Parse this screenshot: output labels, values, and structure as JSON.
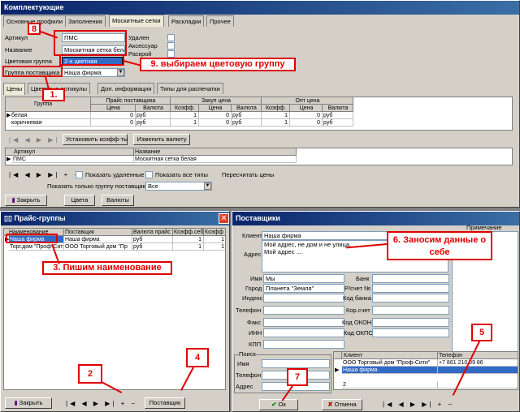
{
  "main": {
    "title": "Комплектующие",
    "tabs": [
      "Основные профили",
      "Заполнения",
      "Москитные сетки",
      "Раскладки",
      "Прочее"
    ],
    "fields": {
      "article_label": "Артикул",
      "article_value": "ПМС",
      "name_label": "Название",
      "name_value": "Москитная сетка белая",
      "colorgroup_label": "Цветовая группа",
      "colorgroup_value": "2-х цветная",
      "suppliergroup_label": "Группа поставщика",
      "suppliergroup_value": "Наша фирма",
      "deleted_label": "Удален",
      "accessory_label": "Аксессуар",
      "cutting_label": "Раскрой"
    },
    "subtabs": [
      "Цены",
      "Цветовые артикулы",
      "Доп. информация",
      "Типы для распечатки"
    ],
    "price_table": {
      "group_headers": [
        "Прайс поставщика",
        "Закуп цена",
        "Опт цена"
      ],
      "columns": [
        "Группа",
        "Цена",
        "Валюта",
        "Коэфф.",
        "Цена",
        "Валюта",
        "Коэфф.",
        "Цена",
        "Валюта"
      ],
      "rows": [
        [
          "белая",
          "0",
          "руб",
          "1",
          "0",
          "руб",
          "1",
          "0",
          "руб"
        ],
        [
          "коричневая",
          "0",
          "руб",
          "1",
          "0",
          "руб",
          "1",
          "0",
          "руб"
        ]
      ]
    },
    "set_coef_button": "Установить коэфф-ты",
    "change_currency_button": "Изменить валюту",
    "list_columns": [
      "Артикул",
      "Название"
    ],
    "list_rows": [
      [
        "ПМС",
        "Москитная сетка белая"
      ]
    ],
    "show_deleted": "Показать удаленные",
    "show_all_types": "Показать все типы",
    "recalc_prices": "Пересчитать цены",
    "show_only_group_label": "Показать только группу поставщика",
    "show_only_group_value": "Все",
    "close_button": "Закрыть",
    "colors_button": "Цвета",
    "currencies_button": "Валюты"
  },
  "price_groups": {
    "title": "Прайс-группы",
    "columns": [
      "Наименование",
      "Поставщик",
      "Валюта прайс",
      "Коэфф.себ",
      "Коэфф"
    ],
    "rows": [
      [
        "Наша фирма",
        "Наша фирма",
        "руб",
        "1",
        "1"
      ],
      [
        "Торг.дом \"Проф-Сити\"",
        "ООО Торговый дом \"Пр",
        "руб",
        "1",
        "1"
      ]
    ],
    "close_button": "Закрыть",
    "supplier_button": "Поставщик"
  },
  "suppliers": {
    "title": "Поставщики",
    "note_header": "Примечание",
    "client_label": "Клиент",
    "client_value": "Наша фирма",
    "address_label": "Адрес",
    "address_value": "Мой адрес, не дом и не улица,\nМой адрес ....",
    "name_label": "Имя",
    "name_value": "Мы",
    "city_label": "Город",
    "city_value": "Планета \"Земля\"",
    "index_label": "Индекс",
    "phone_label": "Телефон",
    "fax_label": "Факс",
    "inn_label": "ИНН",
    "kpp_label": "КПП",
    "bank_label": "Банк",
    "account_label": "Р/счет №",
    "bankcode_label": "Код банка",
    "corr_label": "Кор.счет",
    "okonh_label": "Код ОКОНХ",
    "okpo_label": "Код ОКПО",
    "search_label": "Поиск",
    "search_name": "Имя",
    "search_phone": "Телефон",
    "search_address": "Адрес",
    "list_columns": [
      "Клиент",
      "Телефон"
    ],
    "list_rows": [
      [
        "ООО Торговый дом \"Проф-Сити\"",
        "+7 861 210 09 86"
      ],
      [
        "Наша фирма",
        ""
      ],
      [
        "2",
        ""
      ]
    ],
    "ok_button": "Ок",
    "cancel_button": "Отмена"
  },
  "annotations": {
    "n8": "8",
    "n9": "9. выбираем цветовую группу",
    "n1": "1.",
    "n3": "3. Пишим наименование",
    "n2": "2",
    "n4": "4",
    "n6": "6. Заносим данные о себе",
    "n5": "5",
    "n7": "7"
  },
  "colors": {
    "annotation": "#e00000",
    "title_bar": "#0a246a",
    "selection": "#316ac5"
  }
}
